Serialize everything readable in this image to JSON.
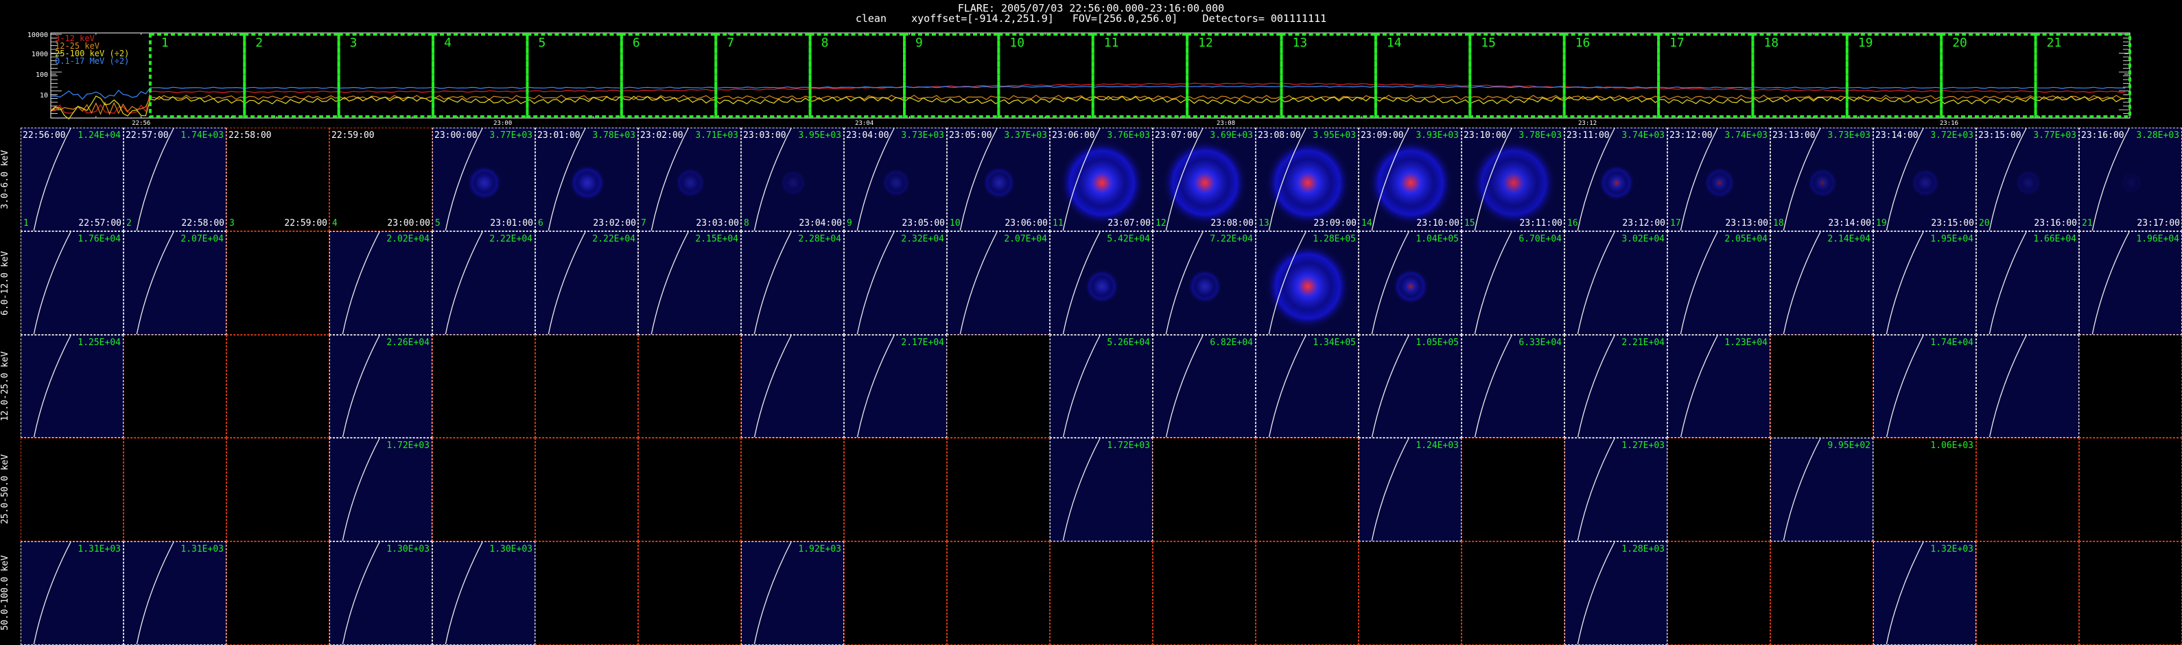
{
  "header": {
    "line1": "FLARE: 2005/07/03 22:56:00.000-23:16:00.000",
    "line2": "clean    xyoffset=[-914.2,251.9]   FOV=[256.0,256.0]    Detectors= 001111111"
  },
  "lightcurve": {
    "y_ticks": [
      "10000",
      "1000",
      "100",
      "10"
    ],
    "x_ticks": [
      "22:56",
      "23:00",
      "23:04",
      "23:08",
      "23:12",
      "23:16"
    ],
    "legend": [
      {
        "label": "3-12 keV",
        "color": "#e02020"
      },
      {
        "label": "12-25 keV",
        "color": "#e08a1a"
      },
      {
        "label": "25-100 keV (÷2)",
        "color": "#e6e020"
      },
      {
        "label": "0.1-17 MeV (÷2)",
        "color": "#3a8aff"
      }
    ],
    "interval_numbers": [
      "1",
      "2",
      "3",
      "4",
      "5",
      "6",
      "7",
      "8",
      "9",
      "10",
      "11",
      "12",
      "13",
      "14",
      "15",
      "16",
      "17",
      "18",
      "19",
      "20",
      "21"
    ]
  },
  "grid": {
    "energy_bands": [
      "3.0-6.0 keV",
      "6.0-12.0 keV",
      "12.0-25.0 keV",
      "25.0-50.0 keV",
      "50.0-100.0 keV"
    ],
    "start_times": [
      "22:56:00",
      "22:57:00",
      "22:58:00",
      "22:59:00",
      "23:00:00",
      "23:01:00",
      "23:02:00",
      "23:03:00",
      "23:04:00",
      "23:05:00",
      "23:06:00",
      "23:07:00",
      "23:08:00",
      "23:09:00",
      "23:10:00",
      "23:11:00",
      "23:12:00",
      "23:13:00",
      "23:14:00",
      "23:15:00",
      "23:16:00"
    ],
    "end_times": [
      "22:57:00",
      "22:58:00",
      "22:59:00",
      "23:00:00",
      "23:01:00",
      "23:02:00",
      "23:03:00",
      "23:04:00",
      "23:05:00",
      "23:06:00",
      "23:07:00",
      "23:08:00",
      "23:09:00",
      "23:10:00",
      "23:11:00",
      "23:12:00",
      "23:13:00",
      "23:14:00",
      "23:15:00",
      "23:16:00",
      "23:17:00"
    ],
    "maxima": [
      [
        "1.24E+04",
        "1.74E+03",
        "",
        "",
        "3.77E+03",
        "3.78E+03",
        "3.71E+03",
        "3.95E+03",
        "3.73E+03",
        "3.37E+03",
        "3.76E+03",
        "3.69E+03",
        "3.95E+03",
        "3.93E+03",
        "3.78E+03",
        "3.74E+03",
        "3.74E+03",
        "3.73E+03",
        "3.72E+03",
        "3.77E+03",
        "3.28E+03"
      ],
      [
        "1.76E+04",
        "2.07E+04",
        "",
        "2.02E+04",
        "2.22E+04",
        "2.22E+04",
        "2.15E+04",
        "2.28E+04",
        "2.32E+04",
        "2.07E+04",
        "5.42E+04",
        "7.22E+04",
        "1.28E+05",
        "1.04E+05",
        "6.70E+04",
        "3.02E+04",
        "2.05E+04",
        "2.14E+04",
        "1.95E+04",
        "1.66E+04",
        "1.96E+04"
      ],
      [
        "1.25E+04",
        "",
        "",
        "2.26E+04",
        "",
        "",
        "",
        "",
        "2.17E+04",
        "",
        "5.26E+04",
        "6.82E+04",
        "1.34E+05",
        "1.05E+05",
        "6.33E+04",
        "2.21E+04",
        "1.23E+04",
        "",
        "1.74E+04",
        "",
        ""
      ],
      [
        "",
        "",
        "",
        "1.72E+03",
        "",
        "",
        "",
        "",
        "",
        "",
        "1.72E+03",
        "",
        "",
        "1.24E+03",
        "",
        "1.27E+03",
        "",
        "9.95E+02",
        "1.06E+03",
        "",
        ""
      ],
      [
        "1.31E+03",
        "1.31E+03",
        "",
        "1.30E+03",
        "1.30E+03",
        "",
        "",
        "1.92E+03",
        "",
        "",
        "",
        "",
        "",
        "",
        "",
        "1.28E+03",
        "",
        "",
        "1.32E+03",
        "",
        ""
      ]
    ],
    "empty_cells": [
      [
        2,
        3
      ],
      [
        2
      ],
      [
        1,
        2,
        4,
        5,
        6,
        9,
        17,
        20
      ],
      [
        0,
        1,
        2,
        4,
        5,
        6,
        7,
        8,
        9,
        11,
        12,
        14,
        16,
        18,
        19,
        20
      ],
      [
        2,
        5,
        6,
        8,
        9,
        10,
        11,
        12,
        13,
        14,
        16,
        17,
        19,
        20
      ]
    ],
    "sources": [
      [
        [
          0,
          0
        ],
        [
          0,
          0
        ],
        [
          0,
          0
        ],
        [
          0,
          0
        ],
        [
          0.55,
          0.5
        ],
        [
          0.6,
          0.5
        ],
        [
          0.4,
          0.5
        ],
        [
          0.25,
          0.5
        ],
        [
          0.35,
          0.5
        ],
        [
          0.5,
          0.5
        ],
        [
          1,
          1
        ],
        [
          1,
          1
        ],
        [
          1,
          1
        ],
        [
          1,
          1
        ],
        [
          0.9,
          0.9
        ],
        [
          0.6,
          0.7
        ],
        [
          0.45,
          0.6
        ],
        [
          0.4,
          0.55
        ],
        [
          0.35,
          0.5
        ],
        [
          0.25,
          0.5
        ],
        [
          0.1,
          0.5
        ]
      ],
      [
        [
          0,
          0
        ],
        [
          0,
          0
        ],
        [
          0,
          0
        ],
        [
          0,
          0
        ],
        [
          0,
          0
        ],
        [
          0,
          0
        ],
        [
          0,
          0
        ],
        [
          0,
          0
        ],
        [
          0,
          0
        ],
        [
          0,
          0
        ],
        [
          0.55,
          0
        ],
        [
          0.55,
          0
        ],
        [
          1,
          1
        ],
        [
          0.6,
          0.8
        ],
        [
          0,
          0
        ],
        [
          0,
          0
        ],
        [
          0,
          0
        ],
        [
          0,
          0
        ],
        [
          0,
          0
        ],
        [
          0,
          0
        ],
        [
          0,
          0
        ]
      ],
      [
        [
          0,
          0
        ],
        [
          0,
          0
        ],
        [
          0,
          0
        ],
        [
          0,
          0
        ],
        [
          0,
          0
        ],
        [
          0,
          0
        ],
        [
          0,
          0
        ],
        [
          0,
          0
        ],
        [
          0,
          0
        ],
        [
          0,
          0
        ],
        [
          0,
          0
        ],
        [
          0,
          0
        ],
        [
          0,
          0
        ],
        [
          0,
          0
        ],
        [
          0,
          0
        ],
        [
          0,
          0
        ],
        [
          0,
          0
        ],
        [
          0,
          0
        ],
        [
          0,
          0
        ],
        [
          0,
          0
        ],
        [
          0,
          0
        ]
      ],
      [
        [
          0,
          0
        ],
        [
          0,
          0
        ],
        [
          0,
          0
        ],
        [
          0,
          0
        ],
        [
          0,
          0
        ],
        [
          0,
          0
        ],
        [
          0,
          0
        ],
        [
          0,
          0
        ],
        [
          0,
          0
        ],
        [
          0,
          0
        ],
        [
          0,
          0
        ],
        [
          0,
          0
        ],
        [
          0,
          0
        ],
        [
          0,
          0
        ],
        [
          0,
          0
        ],
        [
          0,
          0
        ],
        [
          0,
          0
        ],
        [
          0,
          0
        ],
        [
          0,
          0
        ],
        [
          0,
          0
        ],
        [
          0,
          0
        ]
      ],
      [
        [
          0,
          0
        ],
        [
          0,
          0
        ],
        [
          0,
          0
        ],
        [
          0,
          0
        ],
        [
          0,
          0
        ],
        [
          0,
          0
        ],
        [
          0,
          0
        ],
        [
          0,
          0
        ],
        [
          0,
          0
        ],
        [
          0,
          0
        ],
        [
          0,
          0
        ],
        [
          0,
          0
        ],
        [
          0,
          0
        ],
        [
          0,
          0
        ],
        [
          0,
          0
        ],
        [
          0,
          0
        ],
        [
          0,
          0
        ],
        [
          0,
          0
        ],
        [
          0,
          0
        ],
        [
          0,
          0
        ],
        [
          0,
          0
        ]
      ]
    ]
  }
}
